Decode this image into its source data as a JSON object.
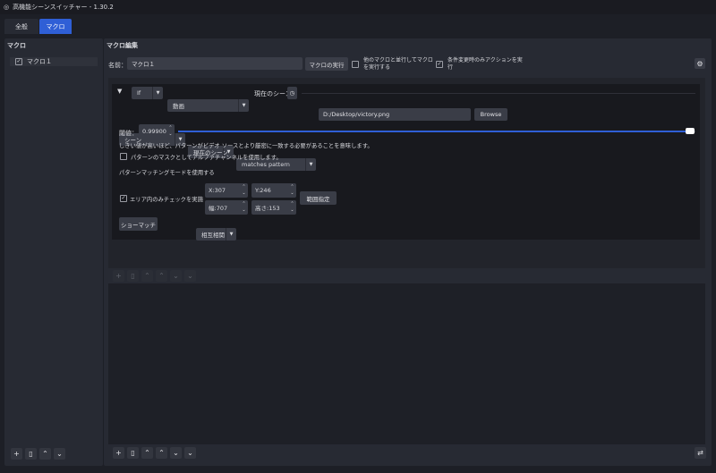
{
  "window": {
    "title": "高機能シーンスイッチャー - 1.30.2"
  },
  "tabs": [
    {
      "label": "全般",
      "active": false
    },
    {
      "label": "マクロ",
      "active": true
    }
  ],
  "accent": "#2f5fd6",
  "left": {
    "title": "マクロ",
    "items": [
      {
        "label": "マクロ１",
        "checked": true
      }
    ],
    "toolbar": [
      "plus-icon",
      "trash-icon",
      "up-icon",
      "down-icon"
    ]
  },
  "editor": {
    "title": "マクロ編集",
    "name_label": "名前：",
    "name_value": "マクロ１",
    "run_button": "マクロの実行",
    "parallel_label": "他のマクロと並行してマクロを実行する",
    "parallel_checked": false,
    "onchange_label": "条件変更時のみアクションを実行",
    "onchange_checked": true,
    "condition": {
      "logic": "If",
      "type": "動画",
      "source_label": "現在のシーン",
      "scene": "シーン",
      "scene_value": "現在のシーン",
      "match": "matches pattern",
      "file": "D:/Desktop/victory.png",
      "browse": "Browse",
      "threshold_label": "閾値：",
      "threshold": "0.99900",
      "threshold_fraction": 0.999,
      "hint": "しきい値が高いほど、パターンがビデオ ソースとより厳密に一致する必要があることを意味します。",
      "alpha_label": "パターンのマスクとしてアルファチャンネルを使用します。",
      "alpha_checked": false,
      "mode_label": "パターンマッチングモードを使用する",
      "mode": "相互相関",
      "area_label": "エリア内のみチェックを実施",
      "area_checked": true,
      "x": "X:307",
      "y": "Y:246",
      "w": "幅:707",
      "h": "高さ:153",
      "area_button": "範囲指定",
      "show_match": "ショーマッチ"
    }
  }
}
